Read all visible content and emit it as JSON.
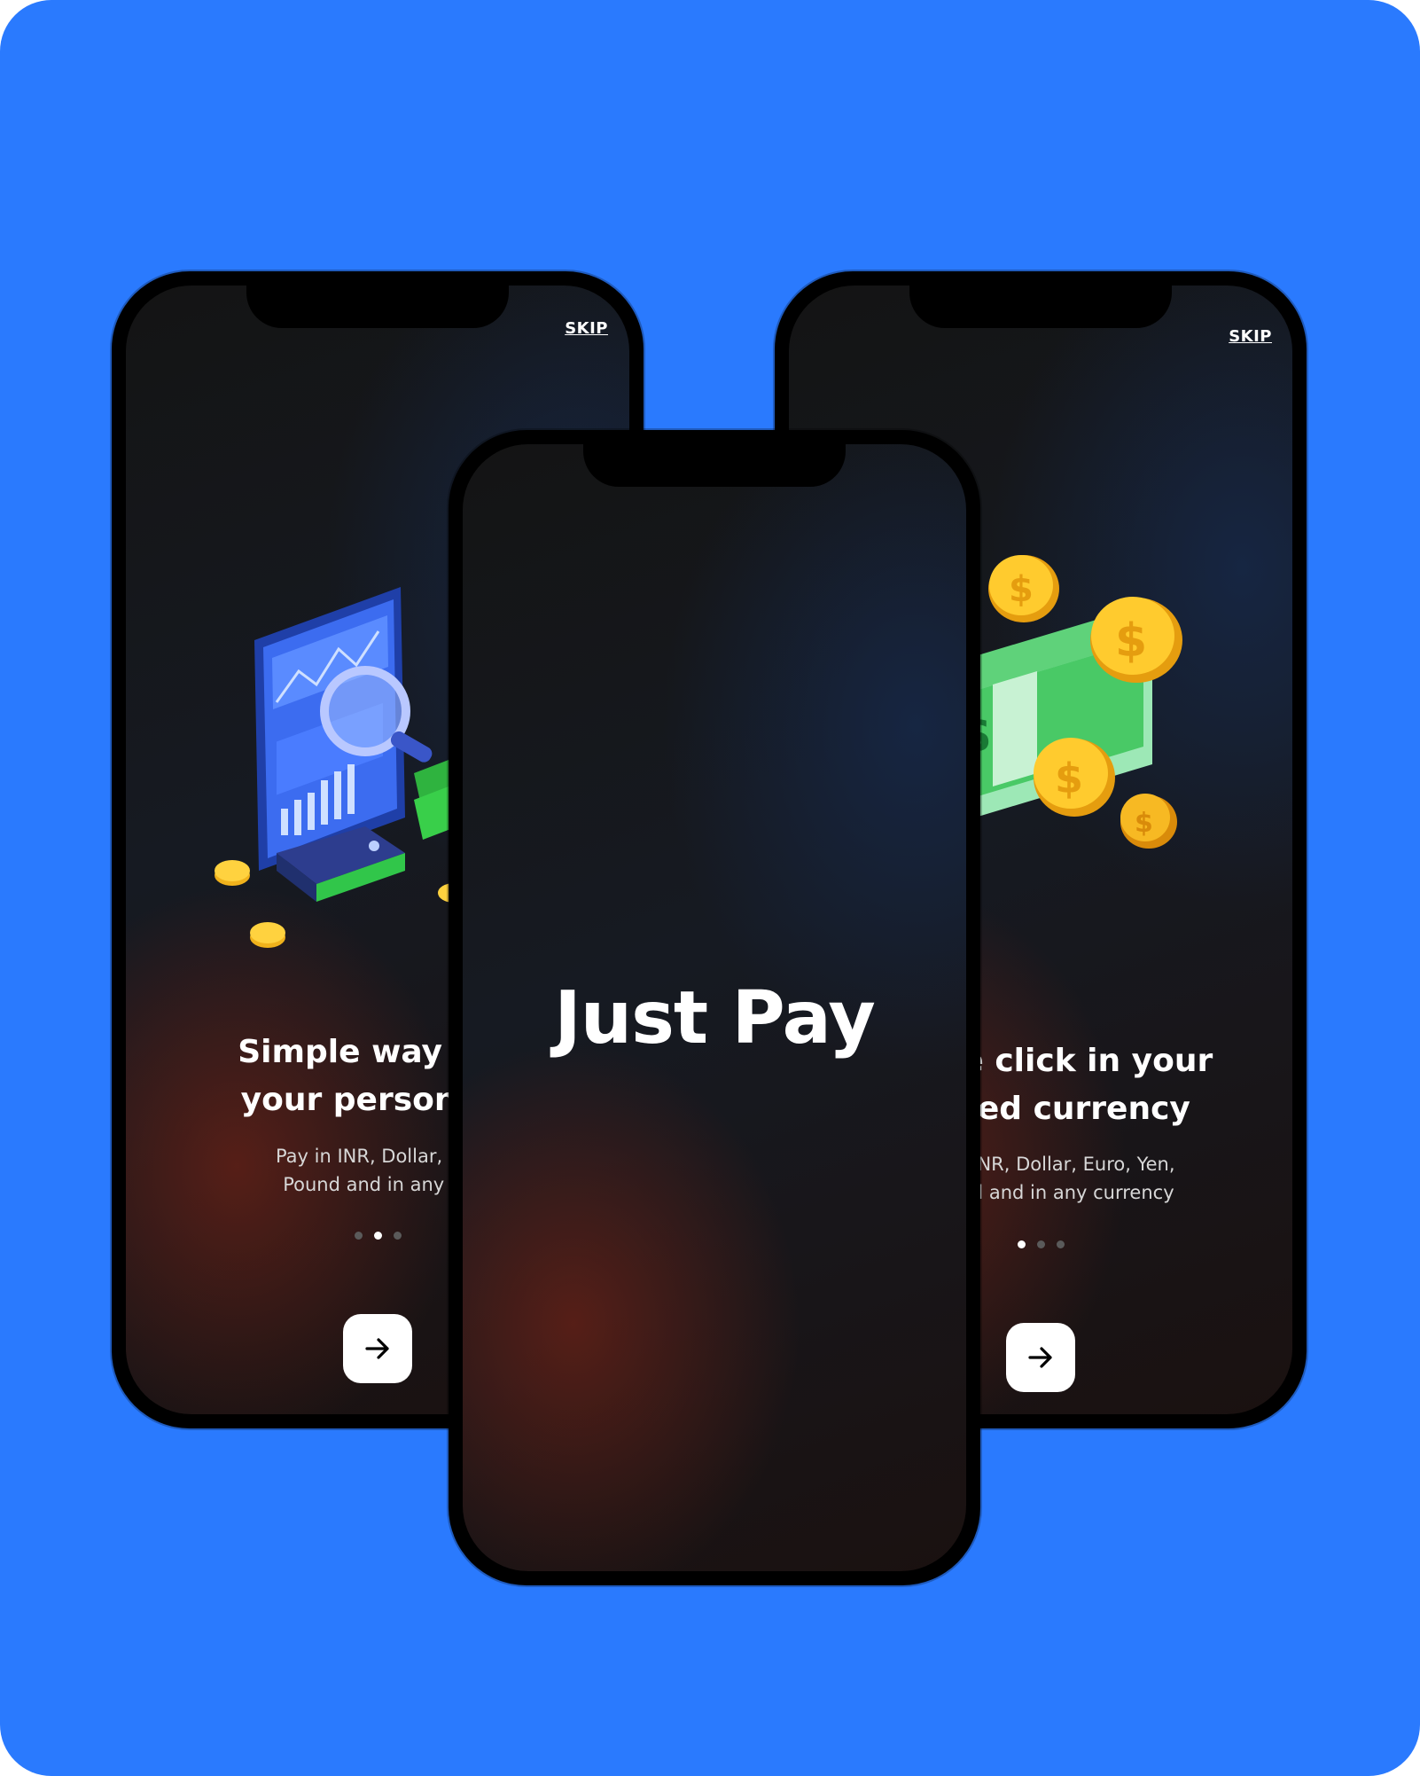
{
  "onboarding_left": {
    "skip_label": "SKIP",
    "headline_line1": "Simple way to r",
    "headline_line2": "your personal f",
    "subtitle_line1": "Pay in INR, Dollar, Eur",
    "subtitle_line2": "Pound and in any cu",
    "page_indicator": {
      "total": 3,
      "active": 2
    },
    "next_icon": "arrow-right-icon",
    "illustration": "phone-analytics-magnifier-wallet-illustration"
  },
  "onboarding_right": {
    "skip_label": "SKIP",
    "headline_line1": "ne click in your",
    "headline_line2": "red currency",
    "subtitle_line1": "NR, Dollar, Euro, Yen,",
    "subtitle_line2": "l and in any currency",
    "page_indicator": {
      "total": 3,
      "active": 1
    },
    "next_icon": "arrow-right-icon",
    "illustration": "cash-and-coins-illustration"
  },
  "splash": {
    "brand_name": "Just Pay"
  },
  "colors": {
    "background": "#2a7afe",
    "screen_dark": "#141414",
    "accent_warm": "#6e2216",
    "button": "#ffffff"
  }
}
